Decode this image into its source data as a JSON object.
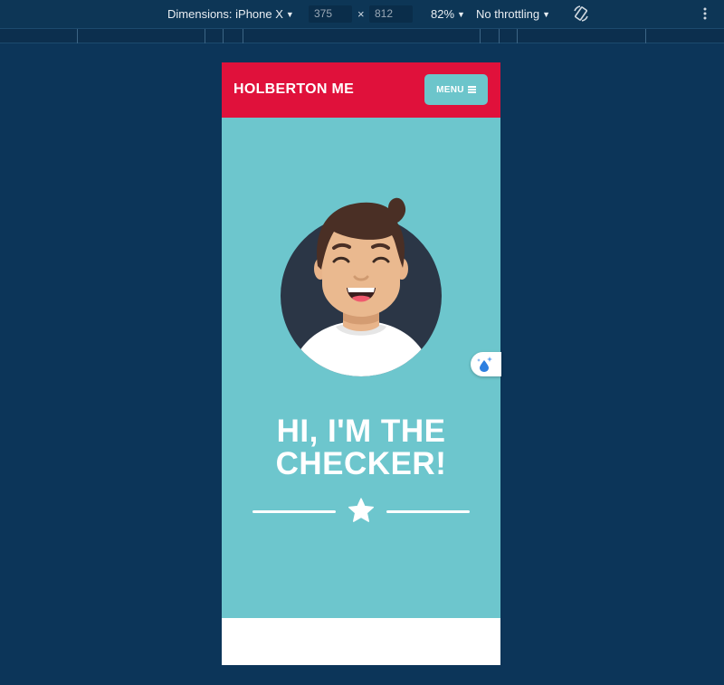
{
  "devtools": {
    "dimensions_label": "Dimensions: iPhone X",
    "width_value": "375",
    "height_value": "812",
    "times_symbol": "×",
    "zoom_label": "82%",
    "throttling_label": "No throttling",
    "icons": [
      "dropdown-caret-icon",
      "rotate-icon",
      "more-options-icon"
    ]
  },
  "site": {
    "brand": "HOLBERTON ME",
    "menu_label": "MENU",
    "menu_icon": "hamburger-icon",
    "hero_title_line1": "HI, I'M THE",
    "hero_title_line2": "CHECKER!",
    "divider_icon": "star-icon",
    "avatar_icon": "smiling-person-avatar"
  },
  "colors": {
    "header_red": "#e0113b",
    "hero_teal": "#6dc6cd",
    "menu_button": "#6cc5cb",
    "page_background": "#0c3559"
  }
}
